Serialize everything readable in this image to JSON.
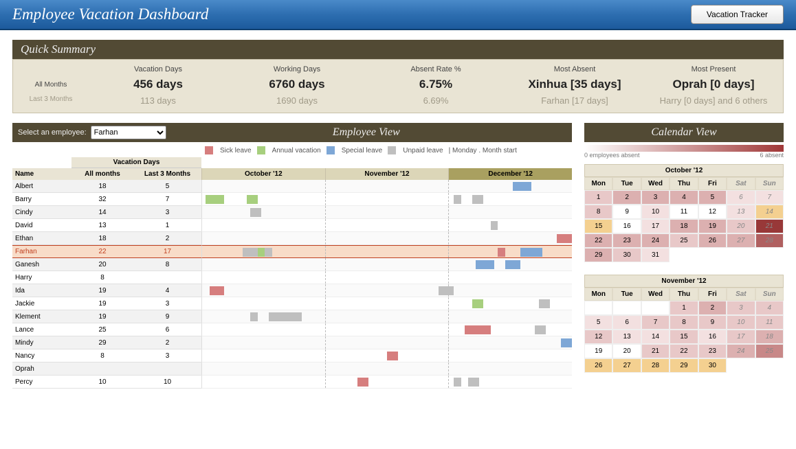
{
  "header": {
    "title": "Employee Vacation Dashboard",
    "button": "Vacation Tracker"
  },
  "quick_summary": {
    "title": "Quick Summary",
    "cols": [
      "Vacation Days",
      "Working Days",
      "Absent Rate %",
      "Most Absent",
      "Most Present"
    ],
    "rows": {
      "all": {
        "label": "All Months",
        "vals": [
          "456 days",
          "6760 days",
          "6.75%",
          "Xinhua [35 days]",
          "Oprah [0 days]"
        ]
      },
      "l3": {
        "label": "Last 3 Months",
        "vals": [
          "113 days",
          "1690 days",
          "6.69%",
          "Farhan [17 days]",
          "Harry [0 days] and 6 others"
        ]
      }
    }
  },
  "employee_view": {
    "title": "Employee View",
    "select_label": "Select an employee:",
    "selected": "Farhan",
    "legend": {
      "sick": "Sick leave",
      "ann": "Annual vacation",
      "spec": "Special leave",
      "unp": "Unpaid leave",
      "marks": "| Monday . Month start"
    },
    "table_headers": {
      "vd": "Vacation Days",
      "name": "Name",
      "all": "All months",
      "l3": "Last 3 Months"
    },
    "months": [
      "October '12",
      "November '12",
      "December '12"
    ],
    "employees": [
      {
        "name": "Albert",
        "all": 18,
        "l3": 5,
        "seg": [
          {
            "t": "spec",
            "s": 84,
            "w": 5
          }
        ]
      },
      {
        "name": "Barry",
        "all": 32,
        "l3": 7,
        "seg": [
          {
            "t": "ann",
            "s": 1,
            "w": 5
          },
          {
            "t": "ann",
            "s": 12,
            "w": 3
          },
          {
            "t": "unp",
            "s": 68,
            "w": 2
          },
          {
            "t": "unp",
            "s": 73,
            "w": 3
          }
        ]
      },
      {
        "name": "Cindy",
        "all": 14,
        "l3": 3,
        "seg": [
          {
            "t": "unp",
            "s": 13,
            "w": 3
          }
        ]
      },
      {
        "name": "David",
        "all": 13,
        "l3": 1,
        "seg": [
          {
            "t": "unp",
            "s": 78,
            "w": 2
          }
        ]
      },
      {
        "name": "Ethan",
        "all": 18,
        "l3": 2,
        "seg": [
          {
            "t": "sick",
            "s": 96,
            "w": 4
          }
        ]
      },
      {
        "name": "Farhan",
        "all": 22,
        "l3": 17,
        "sel": true,
        "seg": [
          {
            "t": "unp",
            "s": 11,
            "w": 4
          },
          {
            "t": "ann",
            "s": 15,
            "w": 2
          },
          {
            "t": "unp",
            "s": 17,
            "w": 2
          },
          {
            "t": "sick",
            "s": 80,
            "w": 2
          },
          {
            "t": "spec",
            "s": 86,
            "w": 6
          }
        ]
      },
      {
        "name": "Ganesh",
        "all": 20,
        "l3": 8,
        "seg": [
          {
            "t": "spec",
            "s": 74,
            "w": 5
          },
          {
            "t": "spec",
            "s": 82,
            "w": 4
          }
        ]
      },
      {
        "name": "Harry",
        "all": 8,
        "l3": "",
        "seg": []
      },
      {
        "name": "Ida",
        "all": 19,
        "l3": 4,
        "seg": [
          {
            "t": "sick",
            "s": 2,
            "w": 4
          },
          {
            "t": "unp",
            "s": 64,
            "w": 4
          }
        ]
      },
      {
        "name": "Jackie",
        "all": 19,
        "l3": 3,
        "seg": [
          {
            "t": "ann",
            "s": 73,
            "w": 3
          },
          {
            "t": "unp",
            "s": 91,
            "w": 3
          }
        ]
      },
      {
        "name": "Klement",
        "all": 19,
        "l3": 9,
        "seg": [
          {
            "t": "unp",
            "s": 13,
            "w": 2
          },
          {
            "t": "unp",
            "s": 18,
            "w": 9
          }
        ]
      },
      {
        "name": "Lance",
        "all": 25,
        "l3": 6,
        "seg": [
          {
            "t": "sick",
            "s": 71,
            "w": 7
          },
          {
            "t": "unp",
            "s": 90,
            "w": 3
          }
        ]
      },
      {
        "name": "Mindy",
        "all": 29,
        "l3": 2,
        "seg": [
          {
            "t": "spec",
            "s": 97,
            "w": 3
          }
        ]
      },
      {
        "name": "Nancy",
        "all": 8,
        "l3": 3,
        "seg": [
          {
            "t": "sick",
            "s": 50,
            "w": 3
          }
        ]
      },
      {
        "name": "Oprah",
        "all": "",
        "l3": "",
        "seg": []
      },
      {
        "name": "Percy",
        "all": 10,
        "l3": 10,
        "seg": [
          {
            "t": "sick",
            "s": 42,
            "w": 3
          },
          {
            "t": "unp",
            "s": 68,
            "w": 2
          },
          {
            "t": "unp",
            "s": 72,
            "w": 3
          }
        ]
      }
    ]
  },
  "calendar_view": {
    "title": "Calendar View",
    "legend_min": "0 employees absent",
    "legend_max": "6 absent",
    "day_headers": [
      "Mon",
      "Tue",
      "Wed",
      "Thu",
      "Fri",
      "Sat",
      "Sun"
    ],
    "months": [
      {
        "name": "October '12",
        "start": 0,
        "ndays": 31,
        "heat": [
          2,
          3,
          3,
          3,
          3,
          1,
          1,
          2,
          0,
          1,
          0,
          0,
          1,
          "y",
          "y",
          0,
          1,
          3,
          3,
          2,
          6,
          3,
          3,
          3,
          2,
          3,
          3,
          5,
          3,
          2,
          1
        ]
      },
      {
        "name": "November '12",
        "start": 3,
        "ndays": 30,
        "heat": [
          2,
          3,
          2,
          2,
          1,
          1,
          2,
          2,
          2,
          2,
          2,
          2,
          1,
          1,
          2,
          1,
          2,
          3,
          0,
          0,
          2,
          2,
          2,
          3,
          4,
          "y",
          "y",
          "y",
          "y",
          "y"
        ]
      }
    ]
  },
  "chart_data": {
    "type": "table",
    "title": "Vacation Days per Employee",
    "columns": [
      "Name",
      "All months",
      "Last 3 Months"
    ],
    "rows": [
      [
        "Albert",
        18,
        5
      ],
      [
        "Barry",
        32,
        7
      ],
      [
        "Cindy",
        14,
        3
      ],
      [
        "David",
        13,
        1
      ],
      [
        "Ethan",
        18,
        2
      ],
      [
        "Farhan",
        22,
        17
      ],
      [
        "Ganesh",
        20,
        8
      ],
      [
        "Harry",
        8,
        null
      ],
      [
        "Ida",
        19,
        4
      ],
      [
        "Jackie",
        19,
        3
      ],
      [
        "Klement",
        19,
        9
      ],
      [
        "Lance",
        25,
        6
      ],
      [
        "Mindy",
        29,
        2
      ],
      [
        "Nancy",
        8,
        3
      ],
      [
        "Oprah",
        null,
        null
      ],
      [
        "Percy",
        10,
        10
      ]
    ]
  }
}
